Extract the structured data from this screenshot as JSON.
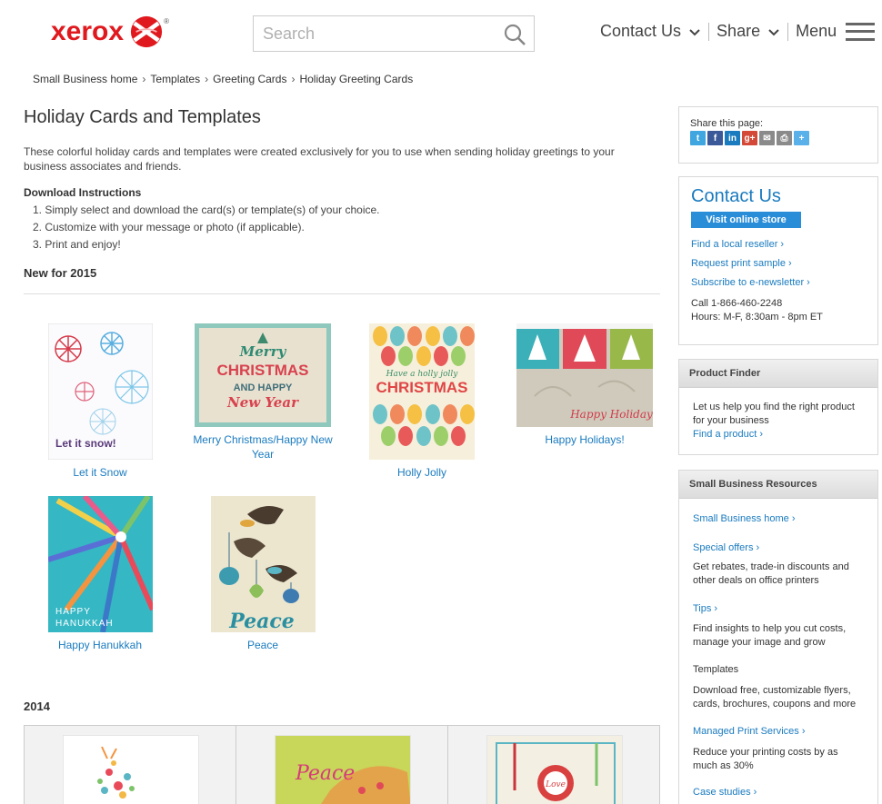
{
  "header": {
    "logo_text": "xerox",
    "logo_reg": "®",
    "search_placeholder": "Search",
    "nav": [
      {
        "label": "Contact Us"
      },
      {
        "label": "Share"
      },
      {
        "label": "Menu"
      }
    ]
  },
  "breadcrumb": [
    "Small Business home",
    "Templates",
    "Greeting Cards",
    "Holiday Greeting Cards"
  ],
  "breadcrumb_sep": "›",
  "main": {
    "title": "Holiday Cards and Templates",
    "intro": "These colorful holiday cards and templates were created exclusively for you to use when sending holiday greetings to your business associates and friends.",
    "download_heading": "Download Instructions",
    "steps": [
      "1.  Simply select and download the card(s) or template(s) of your choice.",
      "2.  Customize with your message or photo (if applicable).",
      "3.  Print and enjoy!"
    ],
    "new_heading": "New for 2015",
    "cards_2015": [
      {
        "caption": "Let it Snow",
        "thumb_text": "Let it snow!"
      },
      {
        "caption": "Merry Christmas/Happy New Year",
        "thumb_text_1": "Merry",
        "thumb_text_2": "CHRISTMAS",
        "thumb_text_3": "AND HAPPY",
        "thumb_text_4": "New Year"
      },
      {
        "caption": "Holly Jolly",
        "thumb_text_1": "Have a holly jolly",
        "thumb_text_2": "CHRISTMAS"
      },
      {
        "caption": "Happy Holidays!",
        "thumb_text": "Happy Holidays!"
      },
      {
        "caption": "Happy Hanukkah",
        "thumb_text_1": "HAPPY",
        "thumb_text_2": "HANUKKAH"
      },
      {
        "caption": "Peace",
        "thumb_text": "Peace"
      }
    ],
    "heading_2014": "2014",
    "cards_2014_text": [
      "Peace",
      "Love"
    ]
  },
  "sidebar": {
    "share_label": "Share this page:",
    "share_icons": [
      "twitter-icon",
      "facebook-icon",
      "linkedin-icon",
      "googleplus-icon",
      "email-icon",
      "print-icon",
      "more-share-icon"
    ],
    "contact": {
      "title": "Contact Us",
      "button": "Visit online store",
      "links": [
        "Find a local reseller ›",
        "Request print sample ›",
        "Subscribe to e-newsletter ›"
      ],
      "phone": "Call 1-866-460-2248",
      "hours": "Hours: M-F, 8:30am - 8pm ET"
    },
    "product_finder": {
      "title": "Product Finder",
      "text": "Let us help you find the right product for your business",
      "link": "Find a product ›"
    },
    "resources": {
      "title": "Small Business Resources",
      "home_link": "Small Business home ›",
      "offers_link": "Special offers ›",
      "offers_text": "Get rebates, trade-in discounts and other deals on office printers",
      "tips_link": "Tips ›",
      "tips_text": "Find insights to help you cut costs, manage your image and grow",
      "templates_label": "Templates",
      "templates_text": "Download free, customizable flyers, cards, brochures, coupons and more",
      "mps_link": "Managed Print Services ›",
      "mps_text": "Reduce your printing costs by as much as 30%",
      "case_link": "Case studies ›"
    }
  },
  "colors": {
    "brand_red": "#e0191e",
    "link_blue": "#1a7bbf",
    "button_blue": "#2a8dd8"
  }
}
